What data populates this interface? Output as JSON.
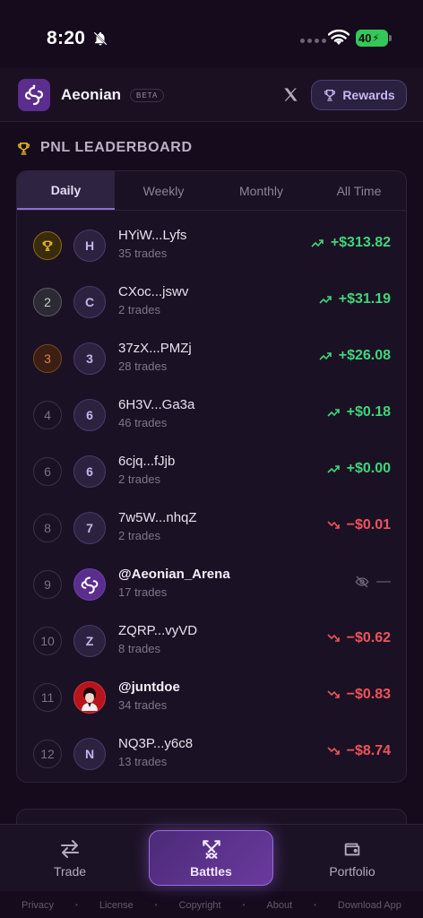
{
  "status_bar": {
    "time": "8:20",
    "battery": "40"
  },
  "header": {
    "app_name": "Aeonian",
    "beta_label": "BETA",
    "rewards_label": "Rewards"
  },
  "section": {
    "title": "PNL LEADERBOARD"
  },
  "tabs": [
    {
      "label": "Daily",
      "active": true
    },
    {
      "label": "Weekly",
      "active": false
    },
    {
      "label": "Monthly",
      "active": false
    },
    {
      "label": "All Time",
      "active": false
    }
  ],
  "rows": [
    {
      "rank": "",
      "avatar": "H",
      "name": "HYiW...Lyfs",
      "trades": "35 trades",
      "pnl": "+$313.82",
      "dir": "up"
    },
    {
      "rank": "2",
      "avatar": "C",
      "name": "CXoc...jswv",
      "trades": "2 trades",
      "pnl": "+$31.19",
      "dir": "up"
    },
    {
      "rank": "3",
      "avatar": "3",
      "name": "37zX...PMZj",
      "trades": "28 trades",
      "pnl": "+$26.08",
      "dir": "up"
    },
    {
      "rank": "4",
      "avatar": "6",
      "name": "6H3V...Ga3a",
      "trades": "46 trades",
      "pnl": "+$0.18",
      "dir": "up"
    },
    {
      "rank": "6",
      "avatar": "6",
      "name": "6cjq...fJjb",
      "trades": "2 trades",
      "pnl": "+$0.00",
      "dir": "up"
    },
    {
      "rank": "8",
      "avatar": "7",
      "name": "7w5W...nhqZ",
      "trades": "2 trades",
      "pnl": "−$0.01",
      "dir": "down"
    },
    {
      "rank": "9",
      "avatar": "",
      "name": "@Aeonian_Arena",
      "trades": "17 trades",
      "pnl": "—",
      "dir": "hidden"
    },
    {
      "rank": "10",
      "avatar": "Z",
      "name": "ZQRP...vyVD",
      "trades": "8 trades",
      "pnl": "−$0.62",
      "dir": "down"
    },
    {
      "rank": "11",
      "avatar": "",
      "name": "@juntdoe",
      "trades": "34 trades",
      "pnl": "−$0.83",
      "dir": "down"
    },
    {
      "rank": "12",
      "avatar": "N",
      "name": "NQ3P...y6c8",
      "trades": "13 trades",
      "pnl": "−$8.74",
      "dir": "down"
    }
  ],
  "nav": {
    "trade": "Trade",
    "battles": "Battles",
    "portfolio": "Portfolio"
  },
  "footer_links": [
    "Privacy",
    "License",
    "Copyright",
    "About",
    "Download App"
  ],
  "colors": {
    "positive": "#3fd67a",
    "negative": "#f0545a",
    "accent": "#8b6fd8",
    "gold": "#e7b71f"
  },
  "icons": {
    "trophy": "trophy-icon",
    "trend_up": "trend-up-icon",
    "trend_down": "trend-down-icon",
    "eye_off": "eye-off-icon",
    "swords": "swords-icon",
    "swap": "swap-icon",
    "wallet": "wallet-icon"
  }
}
